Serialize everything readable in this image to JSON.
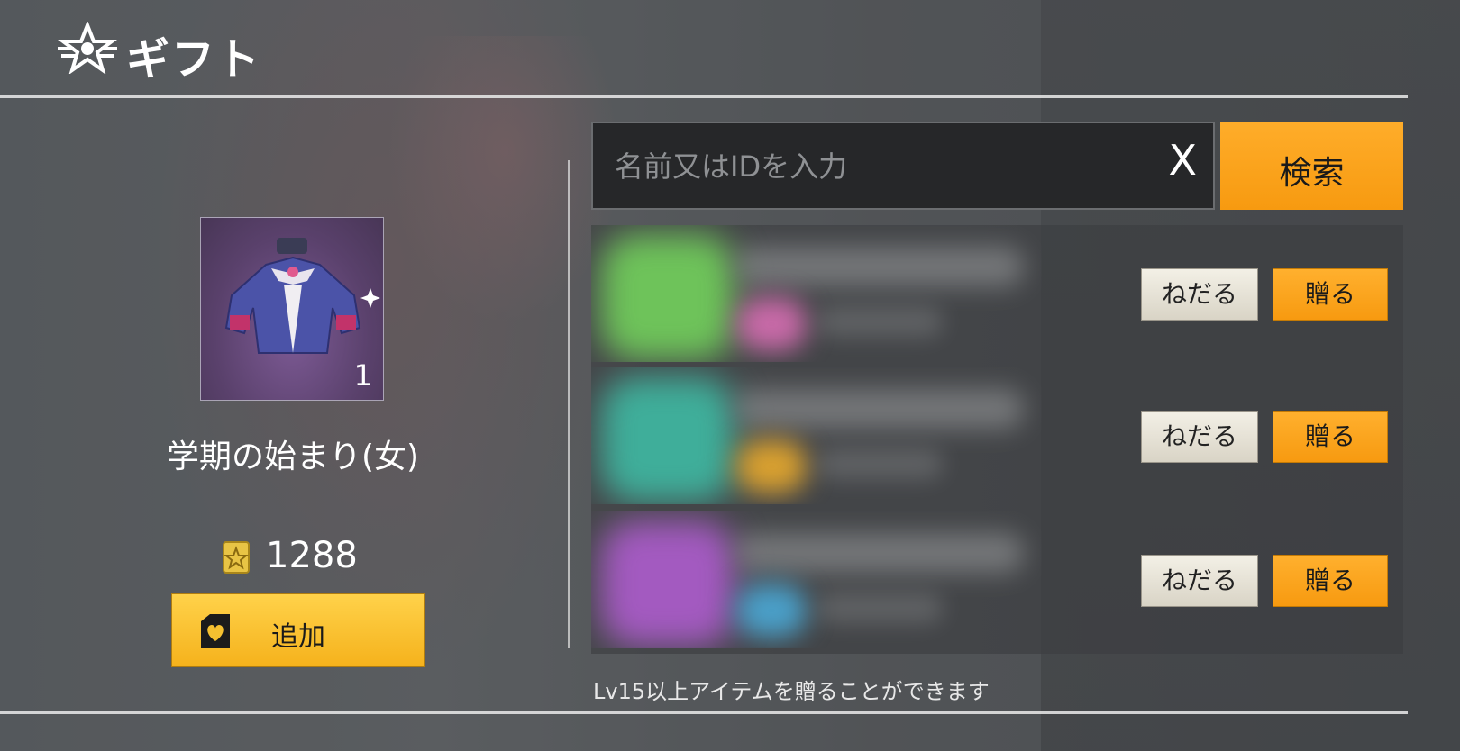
{
  "header": {
    "title": "ギフト",
    "logo_icon": "star-wing-logo-icon"
  },
  "item": {
    "name": "学期の始まり(女)",
    "count": "1",
    "icon": "jacket-costume-icon"
  },
  "currency": {
    "value": "1288",
    "icon": "gold-coupon-icon"
  },
  "add_button": {
    "label": "追加",
    "icon": "heart-card-icon"
  },
  "search": {
    "placeholder": "名前又はIDを入力",
    "value": "",
    "clear_label": "X",
    "button_label": "検索"
  },
  "friends": [
    {
      "request_label": "ねだる",
      "give_label": "贈る",
      "avatar_color": "#6ec35a",
      "badge_color": "#c86aa8"
    },
    {
      "request_label": "ねだる",
      "give_label": "贈る",
      "avatar_color": "#3fae9a",
      "badge_color": "#d8a030"
    },
    {
      "request_label": "ねだる",
      "give_label": "贈る",
      "avatar_color": "#a35ac0",
      "badge_color": "#4a9fc8"
    }
  ],
  "note": "Lv15以上アイテムを贈ることができます",
  "colors": {
    "accent_orange": "#f79a10",
    "accent_yellow": "#ffd24a",
    "panel_dark": "#262729"
  }
}
